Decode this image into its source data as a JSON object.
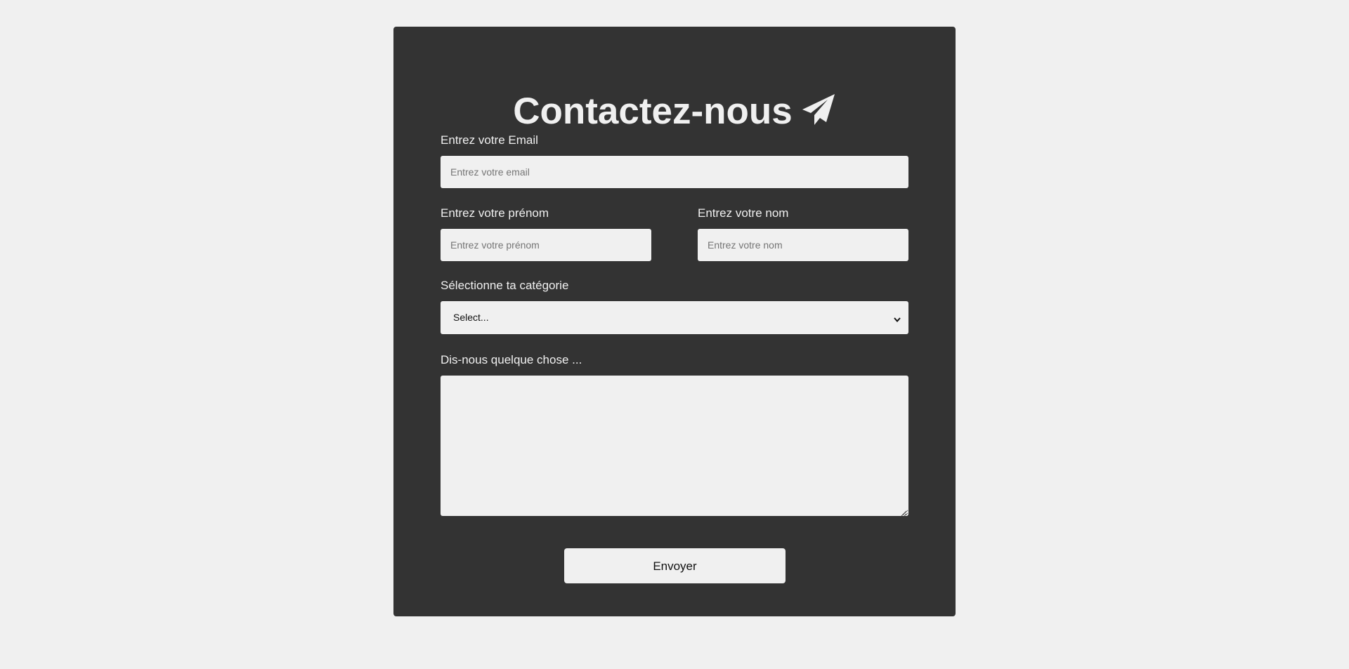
{
  "form": {
    "title": "Contactez-nous",
    "title_icon": "paper-plane-icon",
    "email": {
      "label": "Entrez votre Email",
      "placeholder": "Entrez votre email",
      "value": ""
    },
    "first_name": {
      "label": "Entrez votre prénom",
      "placeholder": "Entrez votre prénom",
      "value": ""
    },
    "last_name": {
      "label": "Entrez votre nom",
      "placeholder": "Entrez votre nom",
      "value": ""
    },
    "category": {
      "label": "Sélectionne ta catégorie",
      "selected": "Select..."
    },
    "message": {
      "label": "Dis-nous quelque chose ...",
      "value": ""
    },
    "submit_label": "Envoyer"
  },
  "colors": {
    "page_background": "#f0f0f0",
    "card_background": "#333333",
    "text_light": "#f0f0f0",
    "field_background": "#f0f0f0"
  }
}
